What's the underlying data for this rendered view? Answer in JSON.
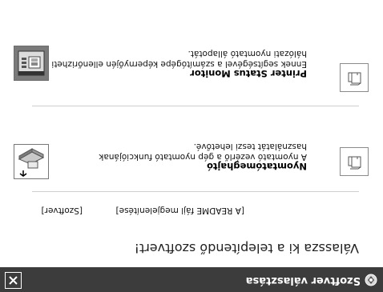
{
  "window": {
    "title": "Szoftver választása"
  },
  "main": {
    "heading": "Válassza ki a telepítendő szoftvert!",
    "links": {
      "readme": "[A README fájl megjelenítése]",
      "back": "[Szoftver]"
    },
    "items": [
      {
        "title": "Nyomtatómeghajtó",
        "description": "A nyomtató vezérlő a gép nyomtató funkciójának használatát teszi lehetővé."
      },
      {
        "title": "Printer Status Monitor",
        "description": "Ennek segítségével a számítógépe képernyőjén ellenőrizheti a hálózati nyomtató állapotát."
      }
    ]
  },
  "icons": {
    "title": "setup-icon",
    "close": "close-icon",
    "install": "install-icon",
    "monitor": "monitor-icon",
    "driver_thumb": "printer-thumbnail",
    "monitor_thumb": "status-monitor-thumbnail"
  },
  "colors": {
    "title_bar": "#3c3c3c",
    "title_text": "#ffffff",
    "background": "#ffffff"
  }
}
